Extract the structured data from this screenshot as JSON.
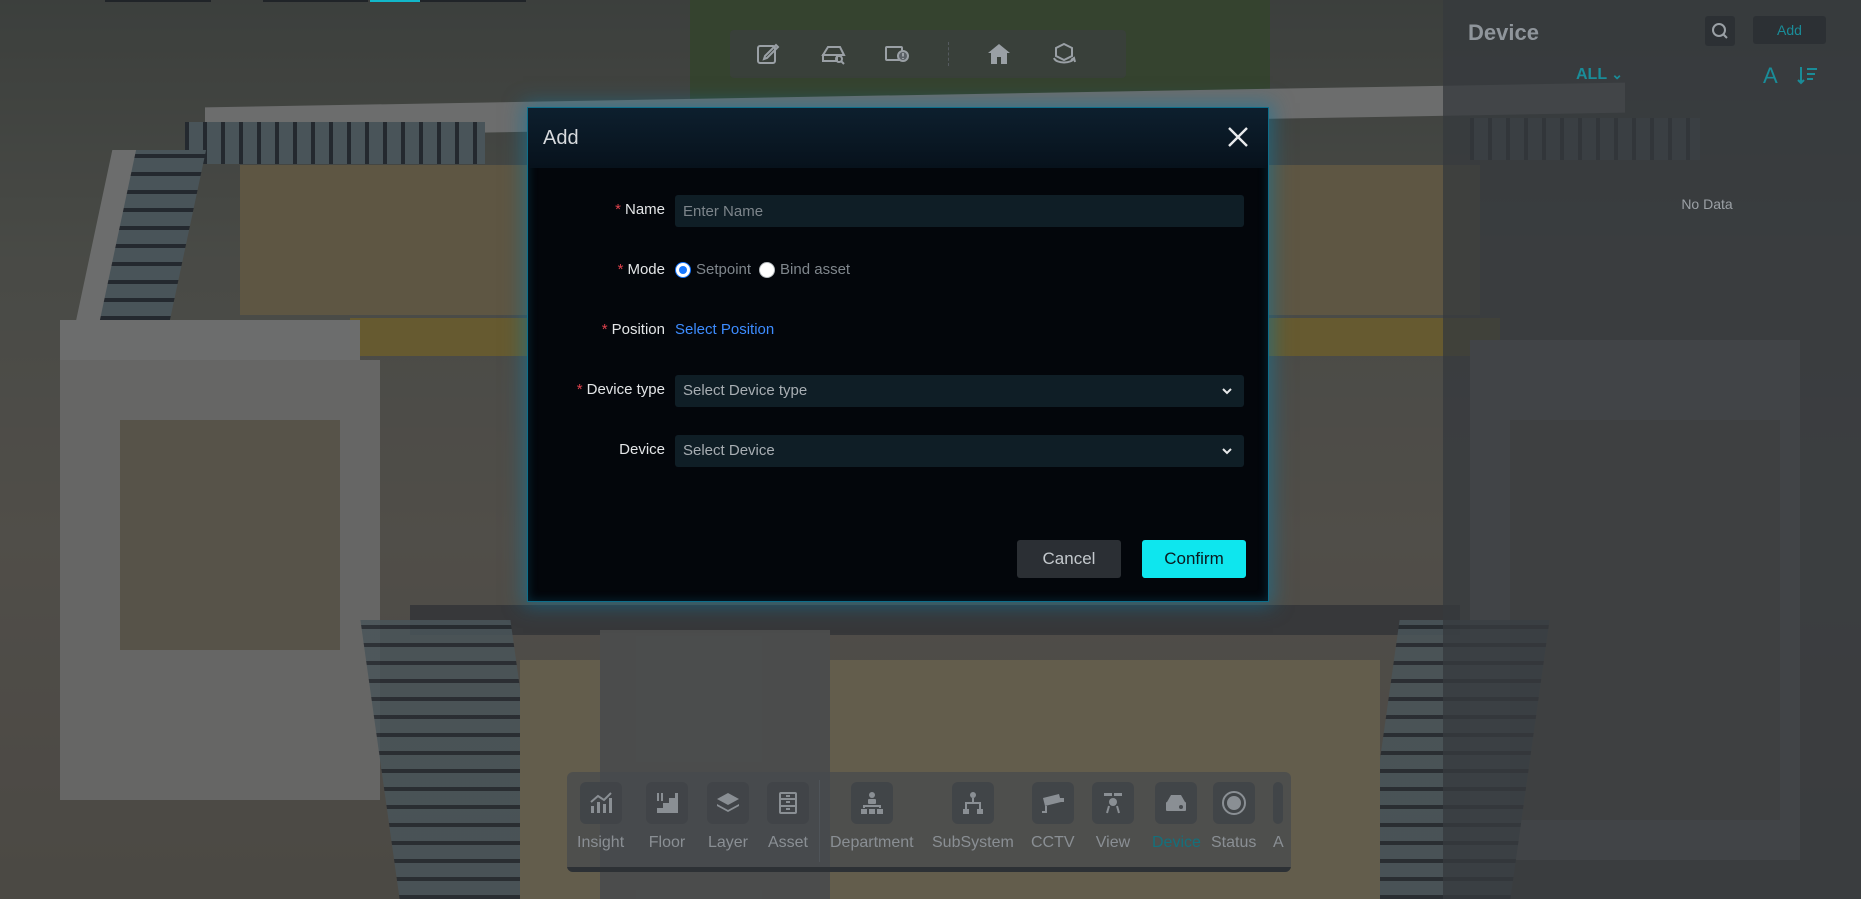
{
  "modal": {
    "title": "Add",
    "fields": {
      "name": {
        "label": "Name",
        "placeholder": "Enter Name",
        "value": "",
        "required": true
      },
      "mode": {
        "label": "Mode",
        "required": true,
        "options": [
          "Setpoint",
          "Bind asset"
        ],
        "selected": "Setpoint"
      },
      "position": {
        "label": "Position",
        "required": true,
        "link": "Select Position"
      },
      "device_type": {
        "label": "Device type",
        "required": true,
        "placeholder": "Select Device type"
      },
      "device": {
        "label": "Device",
        "required": false,
        "placeholder": "Select Device"
      }
    },
    "required_mark": "*",
    "cancel_label": "Cancel",
    "confirm_label": "Confirm"
  },
  "right_panel": {
    "title": "Device",
    "add_label": "Add",
    "filter": "ALL",
    "filter_caret": "⌄",
    "empty_text": "No Data"
  },
  "dock": {
    "items": [
      {
        "label": "Insight",
        "icon": "chart-icon"
      },
      {
        "label": "Floor",
        "icon": "stairs-icon"
      },
      {
        "label": "Layer",
        "icon": "layers-icon"
      },
      {
        "label": "Asset",
        "icon": "cabinet-icon"
      },
      {
        "label": "Department",
        "icon": "org-chart-icon"
      },
      {
        "label": "SubSystem",
        "icon": "subsystem-icon"
      },
      {
        "label": "CCTV",
        "icon": "camera-icon"
      },
      {
        "label": "View",
        "icon": "drone-icon"
      },
      {
        "label": "Device",
        "icon": "device-icon",
        "active": true
      },
      {
        "label": "Status",
        "icon": "status-icon"
      },
      {
        "label": "A",
        "icon": "more-icon"
      }
    ]
  },
  "top_toolbar": {
    "tools": [
      "edit-icon",
      "area-search-icon",
      "alert-screen-icon",
      "home-icon",
      "rotate-view-icon"
    ]
  },
  "colors": {
    "accent": "#0ee6ee",
    "link": "#3d8cff",
    "required": "#e0424d",
    "panel_accent": "#1a8c98"
  }
}
